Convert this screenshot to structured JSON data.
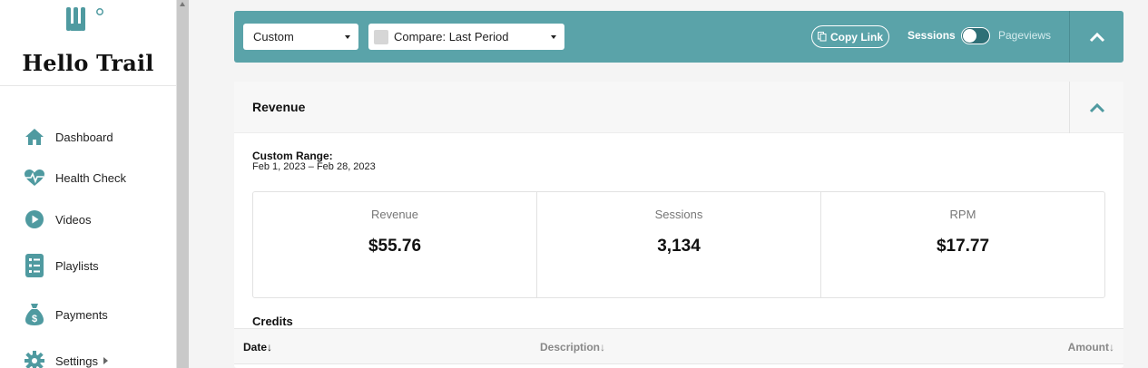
{
  "brand": {
    "name": "Hello Trail"
  },
  "sidebar": {
    "items": [
      {
        "label": "Dashboard",
        "icon": "home-icon"
      },
      {
        "label": "Health Check",
        "icon": "heartbeat-icon"
      },
      {
        "label": "Videos",
        "icon": "play-circle-icon"
      },
      {
        "label": "Playlists",
        "icon": "list-icon"
      },
      {
        "label": "Payments",
        "icon": "money-bag-icon"
      },
      {
        "label": "Settings",
        "icon": "gear-icon"
      }
    ]
  },
  "toolbar": {
    "date_select": "Custom",
    "compare_select": "Compare: Last Period",
    "copy_link": "Copy Link",
    "toggle_left": "Sessions",
    "toggle_right": "Pageviews",
    "toggle_state": "Sessions"
  },
  "panel": {
    "title": "Revenue",
    "range_label": "Custom Range:",
    "range_value": "Feb 1, 2023 – Feb 28, 2023",
    "stats": [
      {
        "label": "Revenue",
        "value": "$55.76"
      },
      {
        "label": "Sessions",
        "value": "3,134"
      },
      {
        "label": "RPM",
        "value": "$17.77"
      }
    ],
    "credits_title": "Credits",
    "table": {
      "columns": [
        "Date↓",
        "Description↓",
        "Amount↓"
      ]
    }
  },
  "colors": {
    "accent": "#5aa3a9",
    "icon": "#4f9aa0"
  }
}
